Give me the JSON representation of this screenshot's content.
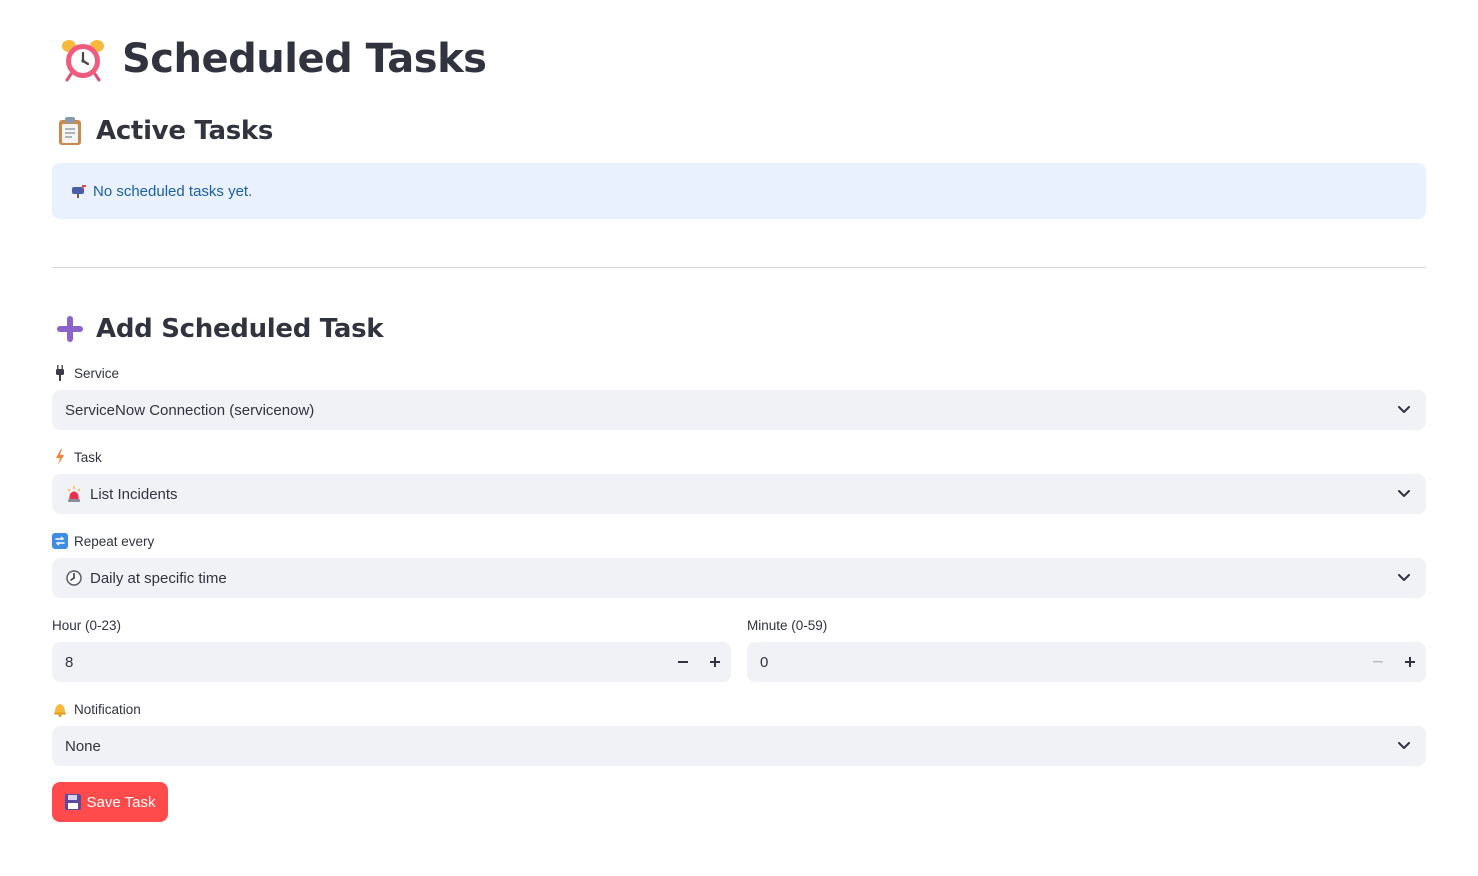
{
  "header": {
    "title": "Scheduled Tasks",
    "icon": "alarm-clock-icon"
  },
  "active_tasks": {
    "title": "Active Tasks",
    "icon": "clipboard-icon",
    "empty_message": "No scheduled tasks yet.",
    "empty_icon": "mailbox-icon"
  },
  "add_task": {
    "title": "Add Scheduled Task",
    "icon": "plus-icon",
    "service": {
      "label": "Service",
      "icon": "plug-icon",
      "value": "ServiceNow Connection (servicenow)"
    },
    "task": {
      "label": "Task",
      "icon": "lightning-icon",
      "value": "List Incidents",
      "value_icon": "siren-icon"
    },
    "repeat": {
      "label": "Repeat every",
      "icon": "repeat-icon",
      "value": "Daily at specific time",
      "value_icon": "clock-icon"
    },
    "hour": {
      "label": "Hour (0-23)",
      "value": "8"
    },
    "minute": {
      "label": "Minute (0-59)",
      "value": "0"
    },
    "notification": {
      "label": "Notification",
      "icon": "bell-icon",
      "value": "None"
    },
    "save_button": {
      "label": "Save Task",
      "icon": "floppy-disk-icon"
    }
  },
  "colors": {
    "primary": "#ff4b4b",
    "info_bg": "#e8f1fd",
    "info_text": "#1b5fa6",
    "input_bg": "#f0f2f6",
    "text": "#31333f"
  }
}
